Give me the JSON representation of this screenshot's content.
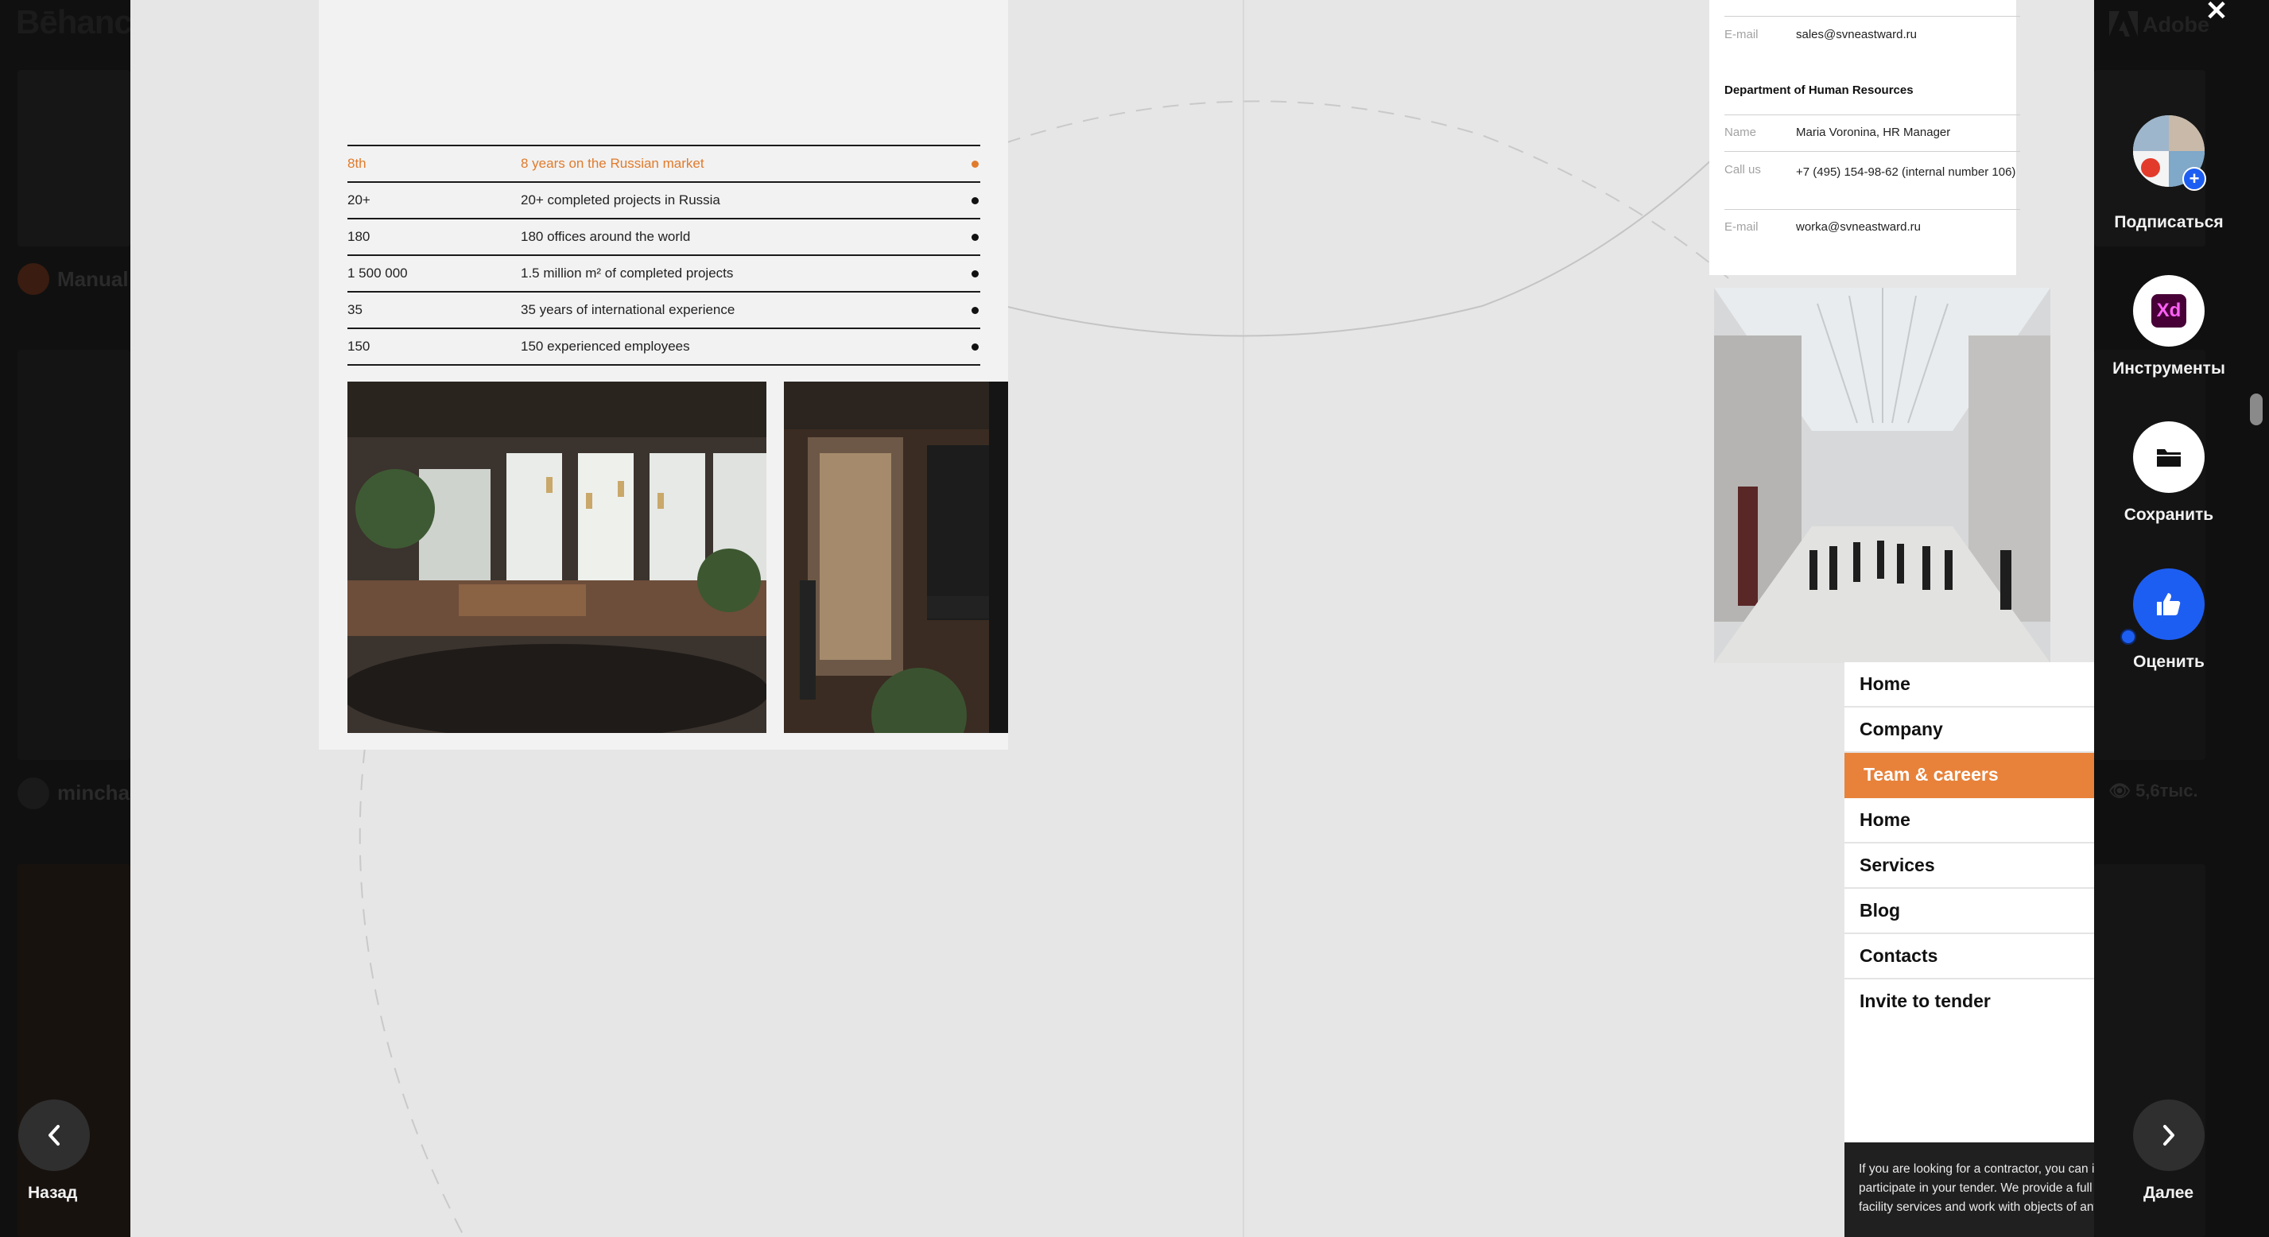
{
  "background": {
    "logo": "Bēhance",
    "adobe": "Adobe",
    "authors": [
      "Manual",
      "minchal"
    ],
    "views": [
      "5,6тыс."
    ]
  },
  "facts": [
    {
      "key": "8th",
      "value": "8 years on the Russian market",
      "highlight": true
    },
    {
      "key": "20+",
      "value": "20+ completed projects in Russia",
      "highlight": false
    },
    {
      "key": "180",
      "value": "180 offices around the world",
      "highlight": false
    },
    {
      "key": "1 500 000",
      "value": "1.5 million m² of completed projects",
      "highlight": false
    },
    {
      "key": "35",
      "value": "35 years of international experience",
      "highlight": false
    },
    {
      "key": "150",
      "value": "150 experienced employees",
      "highlight": false
    }
  ],
  "contacts": {
    "sales_email_label": "E-mail",
    "sales_email": "sales@svneastward.ru",
    "hr_title": "Department of Human Resources",
    "name_label": "Name",
    "name": "Maria Voronina, HR Manager",
    "call_label": "Call us",
    "phone": "+7 (495) 154-98-62 (internal number 106)",
    "hr_email_label": "E-mail",
    "hr_email": "worka@svneastward.ru"
  },
  "menu": [
    {
      "label": "Home",
      "active": false
    },
    {
      "label": "Company",
      "active": false
    },
    {
      "label": "Team & careers",
      "active": true
    },
    {
      "label": "Home",
      "active": false
    },
    {
      "label": "Services",
      "active": false
    },
    {
      "label": "Blog",
      "active": false
    },
    {
      "label": "Contacts",
      "active": false
    },
    {
      "label": "Invite to tender",
      "active": false
    }
  ],
  "tender_text": "If you are looking for a contractor, you can invite us to participate in your tender. We provide a full range of facility services and work with objects of any complexity.",
  "rail": {
    "subscribe": "Подписаться",
    "tools": "Инструменты",
    "tools_badge": "Xd",
    "save": "Сохранить",
    "rate": "Оценить"
  },
  "nav": {
    "back": "Назад",
    "next": "Далее"
  },
  "colors": {
    "accent": "#e8823a",
    "like_blue": "#1d5ef2",
    "xd_purple": "#470137",
    "xd_pink": "#ff61f6"
  }
}
